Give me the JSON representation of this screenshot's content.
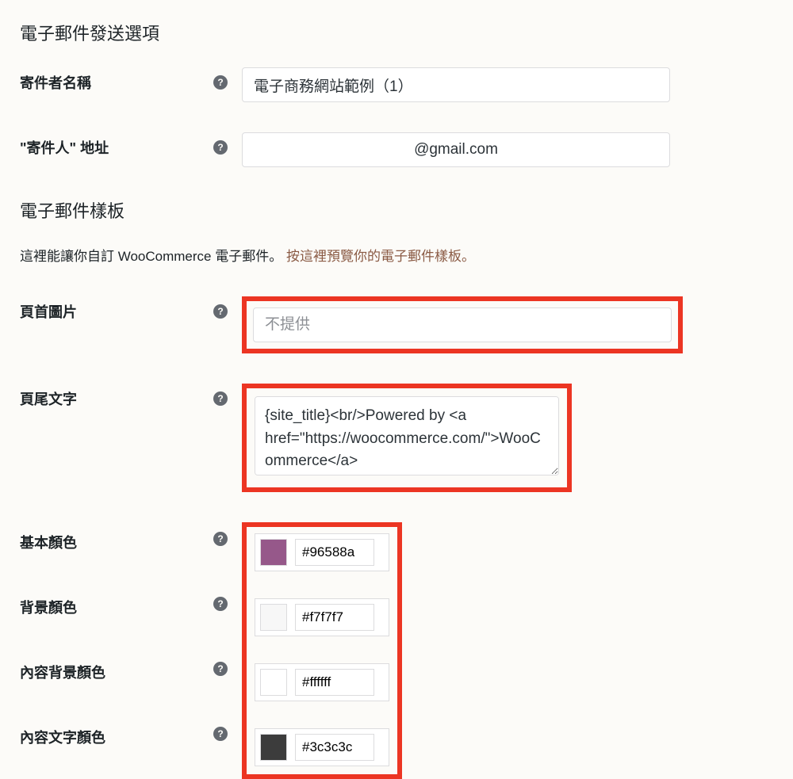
{
  "sections": {
    "sender_options": {
      "heading": "電子郵件發送選項",
      "from_name": {
        "label": "寄件者名稱",
        "value": "電子商務網站範例（1）"
      },
      "from_address": {
        "label": "\"寄件人\" 地址",
        "value": "@gmail.com"
      }
    },
    "email_template": {
      "heading": "電子郵件樣板",
      "description_prefix": "這裡能讓你自訂 WooCommerce 電子郵件。",
      "description_link": "按這裡預覽你的電子郵件樣板。",
      "header_image": {
        "label": "頁首圖片",
        "placeholder": "不提供",
        "value": ""
      },
      "footer_text": {
        "label": "頁尾文字",
        "value": "{site_title}<br/>Powered by <a href=\"https://woocommerce.com/\">WooCommerce</a>"
      },
      "base_color": {
        "label": "基本顏色",
        "value": "#96588a"
      },
      "bg_color": {
        "label": "背景顏色",
        "value": "#f7f7f7"
      },
      "body_bg_color": {
        "label": "內容背景顏色",
        "value": "#ffffff"
      },
      "body_text_color": {
        "label": "內容文字顏色",
        "value": "#3c3c3c"
      }
    }
  }
}
